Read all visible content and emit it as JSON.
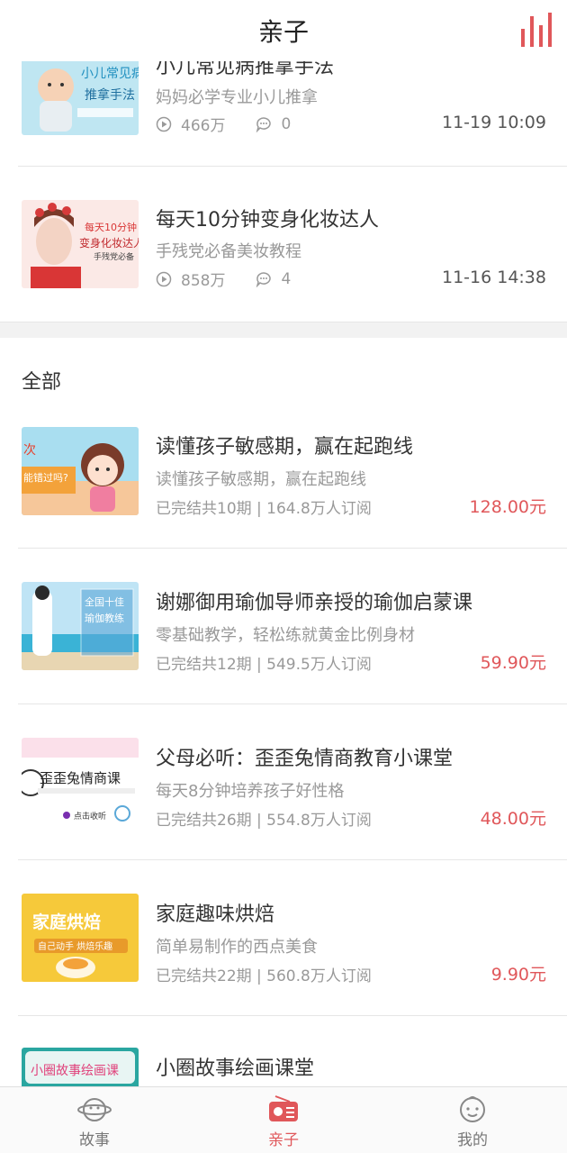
{
  "header": {
    "title": "亲子"
  },
  "featured": [
    {
      "title": "小儿常见病推拿手法",
      "subtitle": "妈妈必学专业小儿推拿",
      "plays": "466万",
      "comments": "0",
      "date": "11-19 10:09",
      "thumb_text": [
        "小儿常见病",
        "推拿手法"
      ]
    },
    {
      "title": "每天10分钟变身化妆达人",
      "subtitle": "手残党必备美妆教程",
      "plays": "858万",
      "comments": "4",
      "date": "11-16 14:38",
      "thumb_text": [
        "每天10分钟",
        "变身化妆达人",
        "手残党必备"
      ]
    }
  ],
  "section": {
    "label": "全部"
  },
  "courses": [
    {
      "title": "读懂孩子敏感期，赢在起跑线",
      "subtitle": "读懂孩子敏感期，赢在起跑线",
      "info": "已完结共10期 | 164.8万人订阅",
      "price": "128.00元",
      "thumb_text": [
        "次",
        "能错过吗?"
      ]
    },
    {
      "title": "谢娜御用瑜伽导师亲授的瑜伽启蒙课",
      "subtitle": "零基础教学，轻松练就黄金比例身材",
      "info": "已完结共12期 | 549.5万人订阅",
      "price": "59.90元",
      "thumb_text": [
        "全国十佳",
        "瑜伽教练"
      ]
    },
    {
      "title": "父母必听：歪歪兔情商教育小课堂",
      "subtitle": "每天8分钟培养孩子好性格",
      "info": "已完结共26期 | 554.8万人订阅",
      "price": "48.00元",
      "thumb_text": [
        "歪歪兔情商课",
        "点击收听"
      ]
    },
    {
      "title": "家庭趣味烘焙",
      "subtitle": "简单易制作的西点美食",
      "info": "已完结共22期 | 560.8万人订阅",
      "price": "9.90元",
      "thumb_text": [
        "家庭烘焙",
        "自己动手 烘焙乐趣"
      ]
    },
    {
      "title": "小圈故事绘画课堂",
      "subtitle": "",
      "info": "",
      "price": "",
      "thumb_text": [
        "小圈故事绘画课"
      ]
    }
  ],
  "tabs": [
    {
      "label": "故事",
      "icon": "planet-face-icon",
      "active": false
    },
    {
      "label": "亲子",
      "icon": "radio-icon",
      "active": true
    },
    {
      "label": "我的",
      "icon": "baby-face-icon",
      "active": false
    }
  ],
  "colors": {
    "accent": "#e0575a",
    "muted": "#999999",
    "title": "#333333"
  }
}
